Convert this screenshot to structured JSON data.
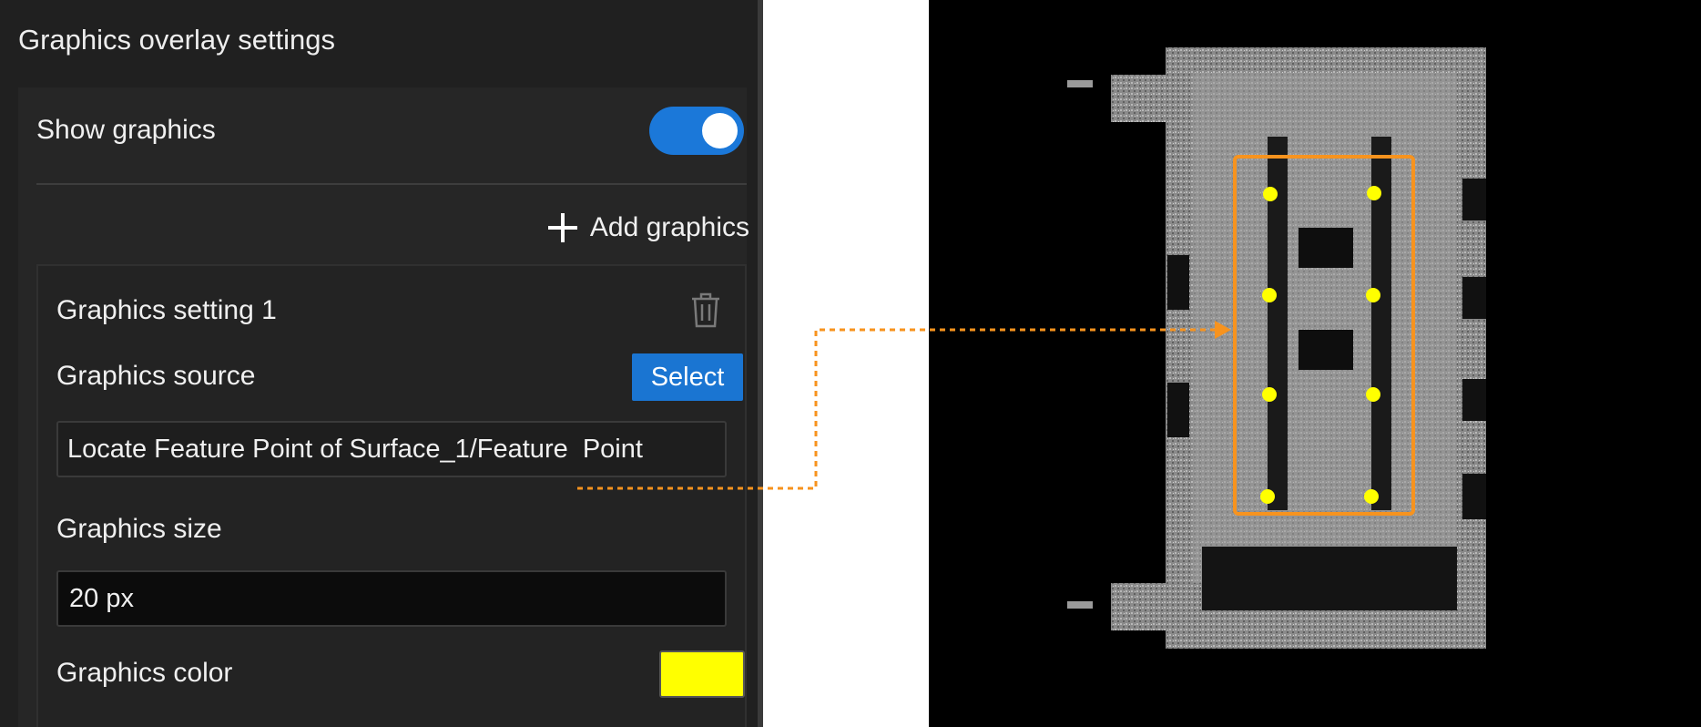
{
  "panel": {
    "title": "Graphics overlay settings",
    "show_graphics": {
      "label": "Show graphics",
      "enabled": true
    },
    "add_graphics_label": "Add graphics",
    "setting": {
      "title": "Graphics setting 1",
      "source_label": "Graphics source",
      "select_label": "Select",
      "source_value": "Locate Feature Point of Surface_1/Feature  Point",
      "size_label": "Graphics size",
      "size_value": "20 px",
      "color_label": "Graphics color",
      "color_value": "#ffff00"
    }
  },
  "preview": {
    "highlight_color": "#f7931e",
    "point_color": "#ffff00"
  }
}
